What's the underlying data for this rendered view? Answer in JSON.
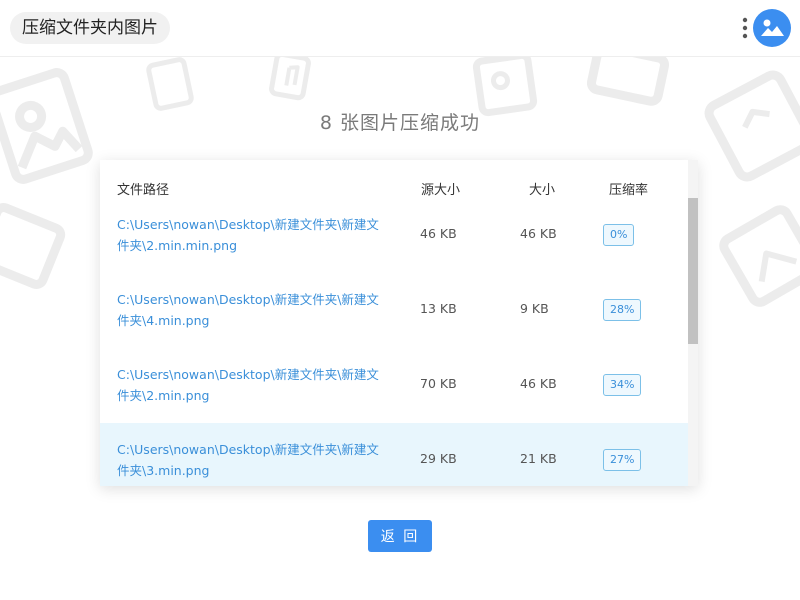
{
  "app": {
    "title": "压缩文件夹内图片"
  },
  "header": {
    "more_icon": "more-vertical-icon",
    "app_icon": "image-app-icon",
    "accent_color": "#3b8ef0"
  },
  "main": {
    "headline": "8 张图片压缩成功"
  },
  "table": {
    "columns": {
      "path": "文件路径",
      "source_size": "源大小",
      "size": "大小",
      "ratio": "压缩率"
    },
    "rows": [
      {
        "path": "C:\\Users\\nowan\\Desktop\\新建文件夹\\新建文件夹\\2.min.min.png",
        "source_size": "46 KB",
        "size": "46 KB",
        "ratio": "0%"
      },
      {
        "path": "C:\\Users\\nowan\\Desktop\\新建文件夹\\新建文件夹\\4.min.png",
        "source_size": "13 KB",
        "size": "9 KB",
        "ratio": "28%"
      },
      {
        "path": "C:\\Users\\nowan\\Desktop\\新建文件夹\\新建文件夹\\2.min.png",
        "source_size": "70 KB",
        "size": "46 KB",
        "ratio": "34%"
      },
      {
        "path": "C:\\Users\\nowan\\Desktop\\新建文件夹\\新建文件夹\\3.min.png",
        "source_size": "29 KB",
        "size": "21 KB",
        "ratio": "27%",
        "selected": true
      }
    ]
  },
  "actions": {
    "back_label": "返 回"
  }
}
